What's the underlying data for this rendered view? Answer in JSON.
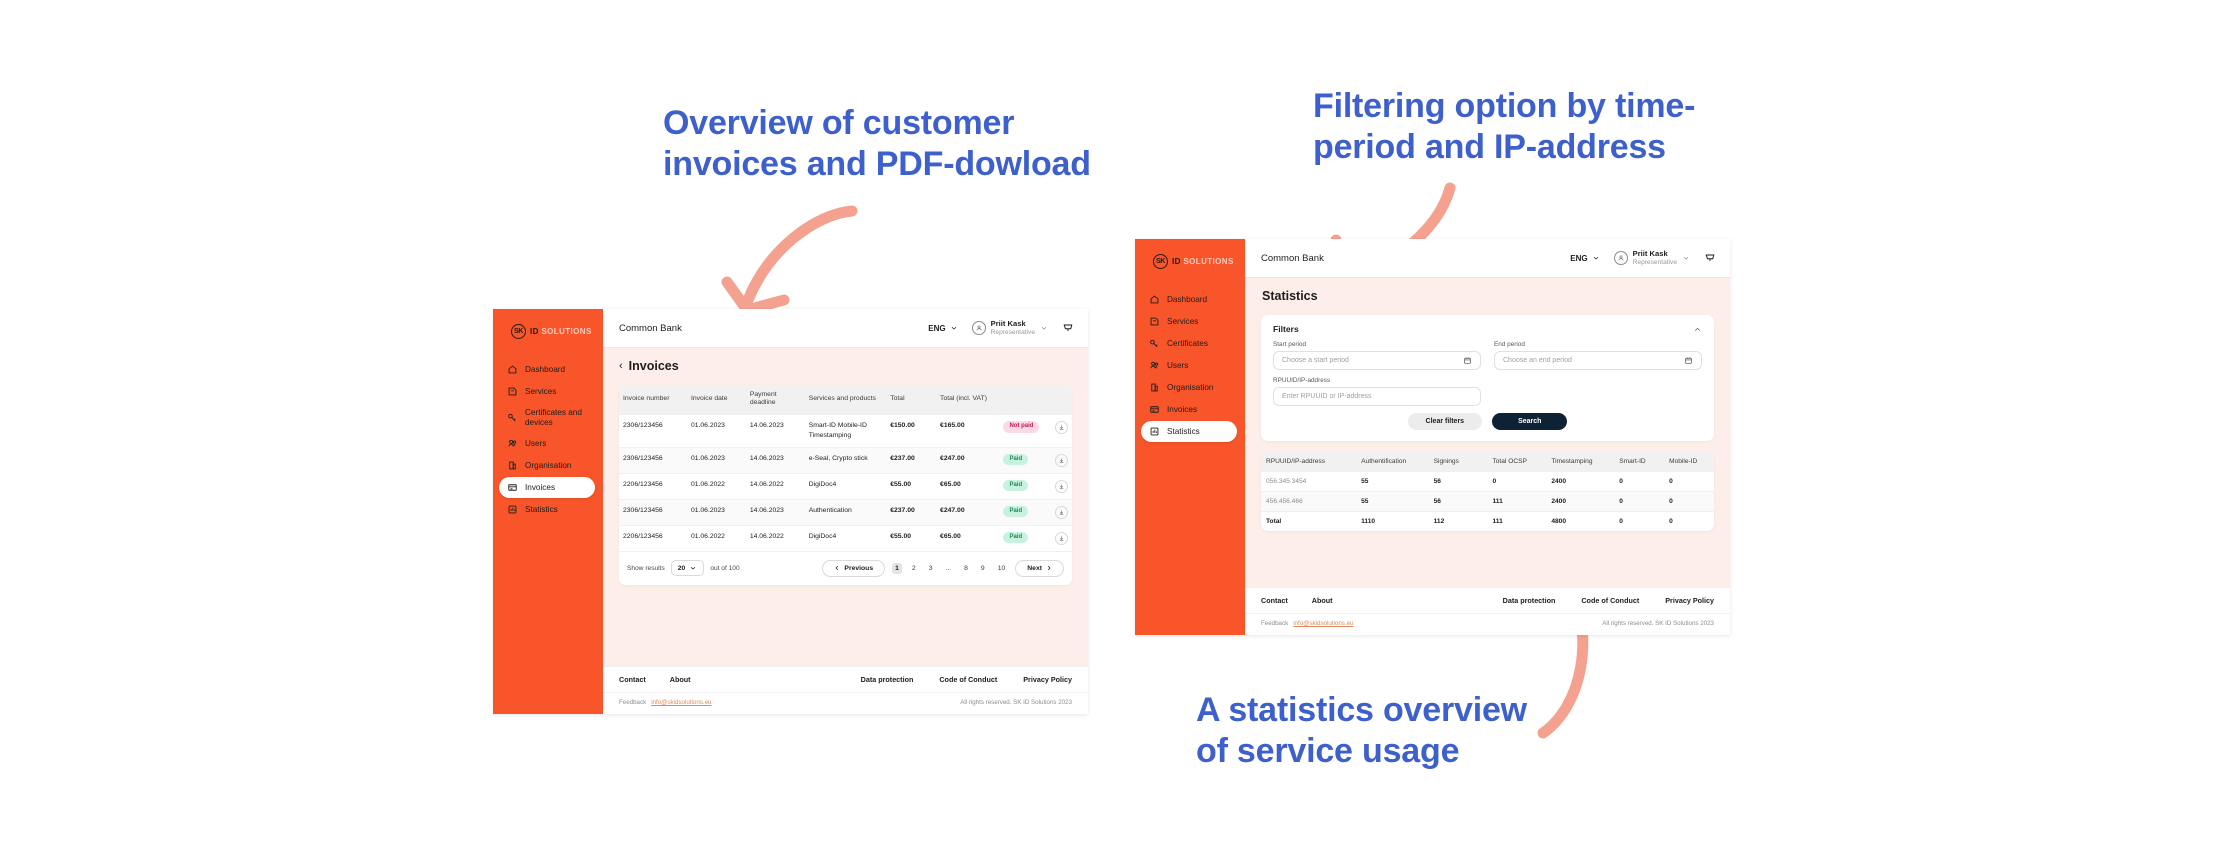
{
  "annotations": {
    "left": "Overview of customer invoices and PDF-dowload",
    "right": "Filtering option by time-period and IP-address",
    "bottom": "A statistics overview of service usage",
    "color": "#3d60cc",
    "arrow_color": "#f5a190"
  },
  "brand": {
    "mark": "SK",
    "word1": "ID",
    "word2": "SOLUTIONS"
  },
  "topbar": {
    "org": "Common Bank",
    "language": "ENG",
    "user_name": "Priit Kask",
    "user_role": "Representative",
    "icons": {
      "chevron": "chevron-down-icon",
      "cart": "cart-icon",
      "avatar": "avatar-icon"
    }
  },
  "invoices_screen": {
    "sidebar": [
      {
        "label": "Dashboard",
        "icon": "home-icon",
        "active": false
      },
      {
        "label": "Services",
        "icon": "services-icon",
        "active": false
      },
      {
        "label": "Certificates and devices",
        "icon": "key-icon",
        "active": false
      },
      {
        "label": "Users",
        "icon": "users-icon",
        "active": false
      },
      {
        "label": "Organisation",
        "icon": "building-icon",
        "active": false
      },
      {
        "label": "Invoices",
        "icon": "invoice-icon",
        "active": true
      },
      {
        "label": "Statistics",
        "icon": "chart-icon",
        "active": false
      }
    ],
    "page_title": "Invoices",
    "back_chevron": "‹",
    "table": {
      "headers": [
        "Invoice number",
        "Invoice date",
        "Payment deadline",
        "Services and products",
        "Total",
        "Total (incl. VAT)",
        "",
        ""
      ],
      "rows": [
        {
          "number": "2306/123456",
          "date": "01.06.2023",
          "deadline": "14.06.2023",
          "services": "Smart-ID Mobile-ID Timestamping",
          "total": "€150.00",
          "total_vat": "€165.00",
          "status": "Not paid",
          "status_kind": "notpaid"
        },
        {
          "number": "2306/123456",
          "date": "01.06.2023",
          "deadline": "14.06.2023",
          "services": "e-Seal, Crypto stick",
          "total": "€237.00",
          "total_vat": "€247.00",
          "status": "Paid",
          "status_kind": "paid"
        },
        {
          "number": "2206/123456",
          "date": "01.06.2022",
          "deadline": "14.06.2022",
          "services": "DigiDoc4",
          "total": "€55.00",
          "total_vat": "€65.00",
          "status": "Paid",
          "status_kind": "paid"
        },
        {
          "number": "2306/123456",
          "date": "01.06.2023",
          "deadline": "14.06.2023",
          "services": "Authentication",
          "total": "€237.00",
          "total_vat": "€247.00",
          "status": "Paid",
          "status_kind": "paid"
        },
        {
          "number": "2206/123456",
          "date": "01.06.2022",
          "deadline": "14.06.2022",
          "services": "DigiDoc4",
          "total": "€55.00",
          "total_vat": "€65.00",
          "status": "Paid",
          "status_kind": "paid"
        }
      ]
    },
    "pagination": {
      "show_results_label": "Show results",
      "page_size": "20",
      "out_of": "out of 100",
      "previous": "Previous",
      "next": "Next",
      "pages": [
        "1",
        "2",
        "3",
        "...",
        "8",
        "9",
        "10"
      ],
      "current_page": "1"
    }
  },
  "statistics_screen": {
    "sidebar": [
      {
        "label": "Dashboard",
        "icon": "home-icon",
        "active": false
      },
      {
        "label": "Services",
        "icon": "services-icon",
        "active": false
      },
      {
        "label": "Certificates",
        "icon": "key-icon",
        "active": false
      },
      {
        "label": "Users",
        "icon": "users-icon",
        "active": false
      },
      {
        "label": "Organisation",
        "icon": "building-icon",
        "active": false
      },
      {
        "label": "Invoices",
        "icon": "invoice-icon",
        "active": false
      },
      {
        "label": "Statistics",
        "icon": "chart-icon",
        "active": true
      }
    ],
    "page_title": "Statistics",
    "filters": {
      "title": "Filters",
      "collapse_icon": "chevron-up-icon",
      "start_period_label": "Start period",
      "start_period_placeholder": "Choose a start period",
      "end_period_label": "End period",
      "end_period_placeholder": "Choose an end period",
      "rpuuid_label": "RPUUID/IP-address",
      "rpuuid_placeholder": "Enter RPUUID or IP-address",
      "clear_button": "Clear filters",
      "search_button": "Search"
    },
    "table": {
      "headers": [
        "RPUUID/IP-address",
        "Authentification",
        "Signings",
        "Total OCSP",
        "Timestamping",
        "Smart-ID",
        "Mobile-ID"
      ],
      "rows": [
        {
          "ip": "056.345.3454",
          "auth": "55",
          "signings": "56",
          "ocsp": "0",
          "timestamping": "2400",
          "smartid": "0",
          "mobileid": "0",
          "is_total": false
        },
        {
          "ip": "456.456.466",
          "auth": "55",
          "signings": "56",
          "ocsp": "111",
          "timestamping": "2400",
          "smartid": "0",
          "mobileid": "0",
          "is_total": false
        },
        {
          "ip": "Total",
          "auth": "1110",
          "signings": "112",
          "ocsp": "111",
          "timestamping": "4800",
          "smartid": "0",
          "mobileid": "0",
          "is_total": true
        }
      ]
    }
  },
  "footer": {
    "links_left": [
      "Contact",
      "About"
    ],
    "links_right": [
      "Data protection",
      "Code of Conduct",
      "Privacy Policy"
    ],
    "feedback_label": "Feedback",
    "feedback_email": "info@skidsolutions.eu",
    "rights": "All rights reserved. SK ID Solutions 2023"
  }
}
